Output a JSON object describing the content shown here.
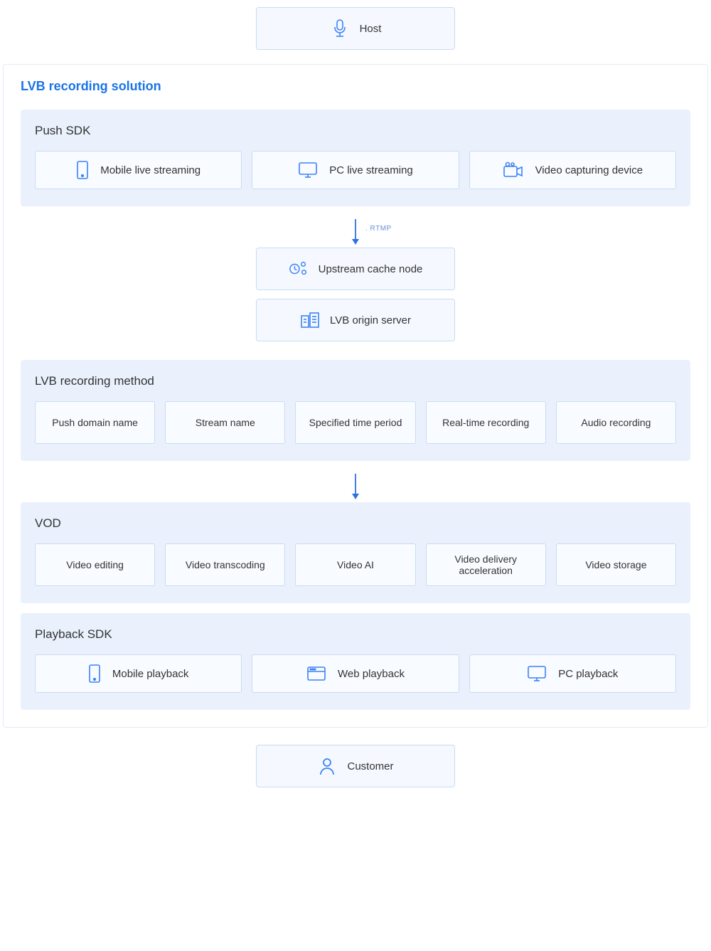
{
  "colors": {
    "accent": "#1a73e8",
    "icon": "#3b82f6",
    "panel": "#eaf1fc",
    "cell": "#f8fbff",
    "border": "#c9dcf2"
  },
  "host": {
    "label": "Host"
  },
  "title": "LVB recording solution",
  "push_sdk": {
    "title": "Push SDK",
    "items": [
      "Mobile live streaming",
      "PC live streaming",
      "Video capturing device"
    ]
  },
  "rtmp_label": ". RTMP",
  "upstream": {
    "label": "Upstream cache node"
  },
  "origin": {
    "label": "LVB origin server"
  },
  "recording": {
    "title": "LVB recording method",
    "items": [
      "Push domain name",
      "Stream name",
      "Specified time period",
      "Real-time recording",
      "Audio recording"
    ]
  },
  "vod": {
    "title": "VOD",
    "items": [
      "Video editing",
      "Video transcoding",
      "Video AI",
      "Video delivery acceleration",
      "Video storage"
    ]
  },
  "playback_sdk": {
    "title": "Playback SDK",
    "items": [
      "Mobile playback",
      "Web playback",
      "PC playback"
    ]
  },
  "customer": {
    "label": "Customer"
  }
}
